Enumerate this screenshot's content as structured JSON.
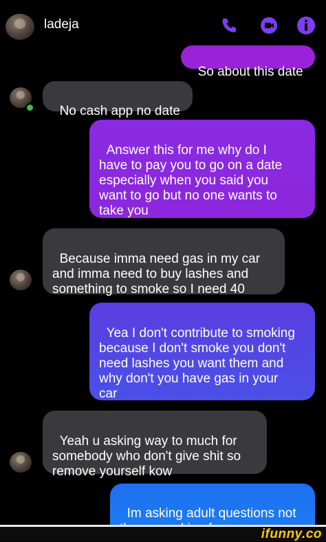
{
  "header": {
    "contact_name": "ladeja",
    "icons": [
      "phone-icon",
      "video-call-icon",
      "info-icon"
    ],
    "accent_color": "#8a2be2"
  },
  "messages": [
    {
      "sender": "me",
      "text": "So about this date"
    },
    {
      "sender": "them",
      "text": "No cash app no date"
    },
    {
      "sender": "me",
      "text": "Answer this for me why do I\nhave to pay you to go on a date\nespecially when you said you\nwant to go but no one wants to\ntake you"
    },
    {
      "sender": "them",
      "text": "Because imma need gas in my car\nand imma need to buy lashes and\nsomething to smoke so I need 40"
    },
    {
      "sender": "me",
      "text": "Yea I don't contribute to smoking\nbecause I don't smoke you don't\nneed lashes you want them and\nwhy don't you have gas in your\ncar"
    },
    {
      "sender": "them",
      "text": "Yeah u asking way to much for\nsomebody who don't give shit so\nremove yourself kow"
    },
    {
      "sender": "me",
      "text": "Im asking adult questions not\nthe one asking for money"
    }
  ],
  "watermark": {
    "text": "ifunny.co"
  }
}
